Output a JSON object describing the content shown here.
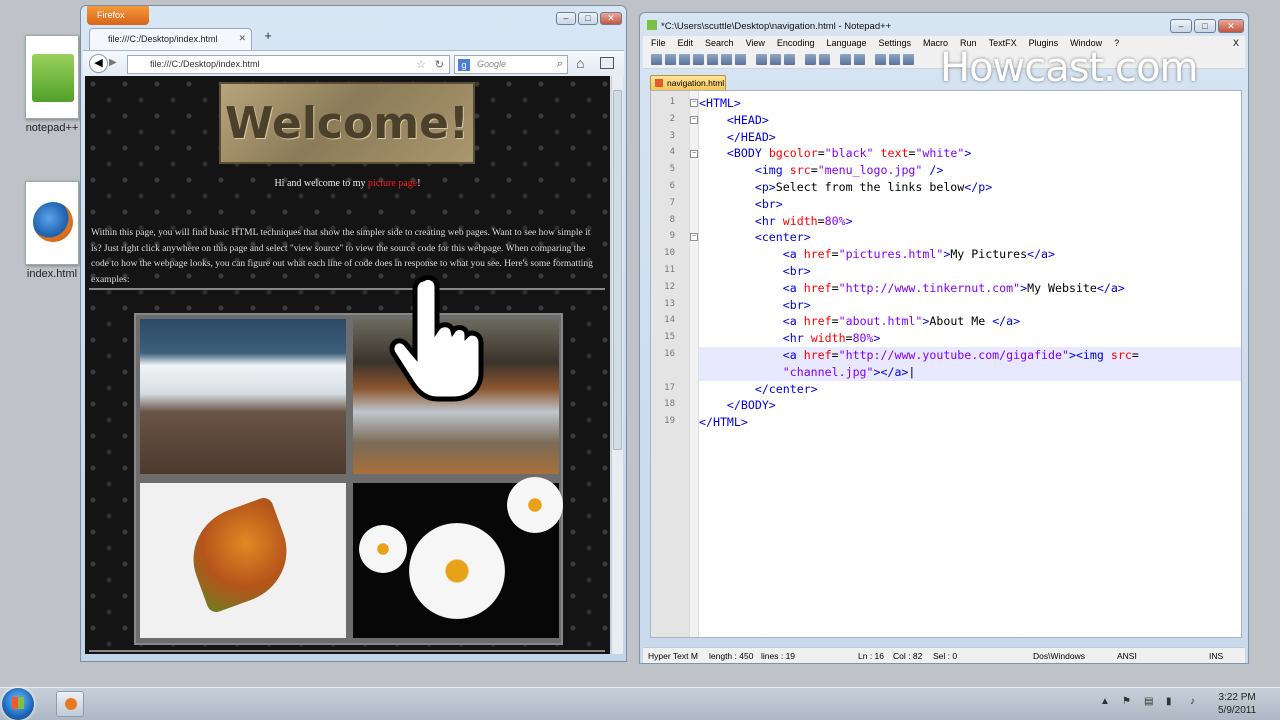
{
  "desktop": {
    "icons": [
      {
        "name": "notepad++"
      },
      {
        "name": "index.html"
      }
    ]
  },
  "firefox": {
    "menu_button": "Firefox",
    "tab_title": "file:///C:/Desktop/index.html",
    "url": "file:///C:/Desktop/index.html",
    "search_placeholder": "Google",
    "page": {
      "logo_text": "Welcome!",
      "greeting_before": "Hi and welcome to my ",
      "greeting_link": "picture page",
      "greeting_after": "!",
      "paragraph": "Within this page, you will find basic HTML techniques that show the simpler side to creating web pages.  Want to see how simple it is? Just right click anywhere on this page and select \"view source\" to view the source code for this webpage. When comparing the code to how the webpage looks, you can figure out what each line of code does in response to what you see.  Here's some formatting examples:"
    }
  },
  "notepad": {
    "title": "*C:\\Users\\scuttle\\Desktop\\navigation.html - Notepad++",
    "menu": [
      "File",
      "Edit",
      "Search",
      "View",
      "Encoding",
      "Language",
      "Settings",
      "Macro",
      "Run",
      "TextFX",
      "Plugins",
      "Window",
      "?"
    ],
    "menu_close": "X",
    "doc_tab": "navigation.html",
    "watermark": "Howcast.com",
    "line_numbers": [
      "1",
      "2",
      "3",
      "4",
      "5",
      "6",
      "7",
      "8",
      "9",
      "10",
      "11",
      "12",
      "13",
      "14",
      "15",
      "16",
      "",
      "17",
      "18",
      "19"
    ],
    "status": {
      "type": "Hyper Text M",
      "length": "length : 450",
      "lines": "lines : 19",
      "ln": "Ln : 16",
      "col": "Col : 82",
      "sel": "Sel : 0",
      "eol": "Dos\\Windows",
      "enc": "ANSI",
      "mode": "INS"
    }
  },
  "taskbar": {
    "time": "3:22 PM",
    "date": "5/9/2011"
  }
}
